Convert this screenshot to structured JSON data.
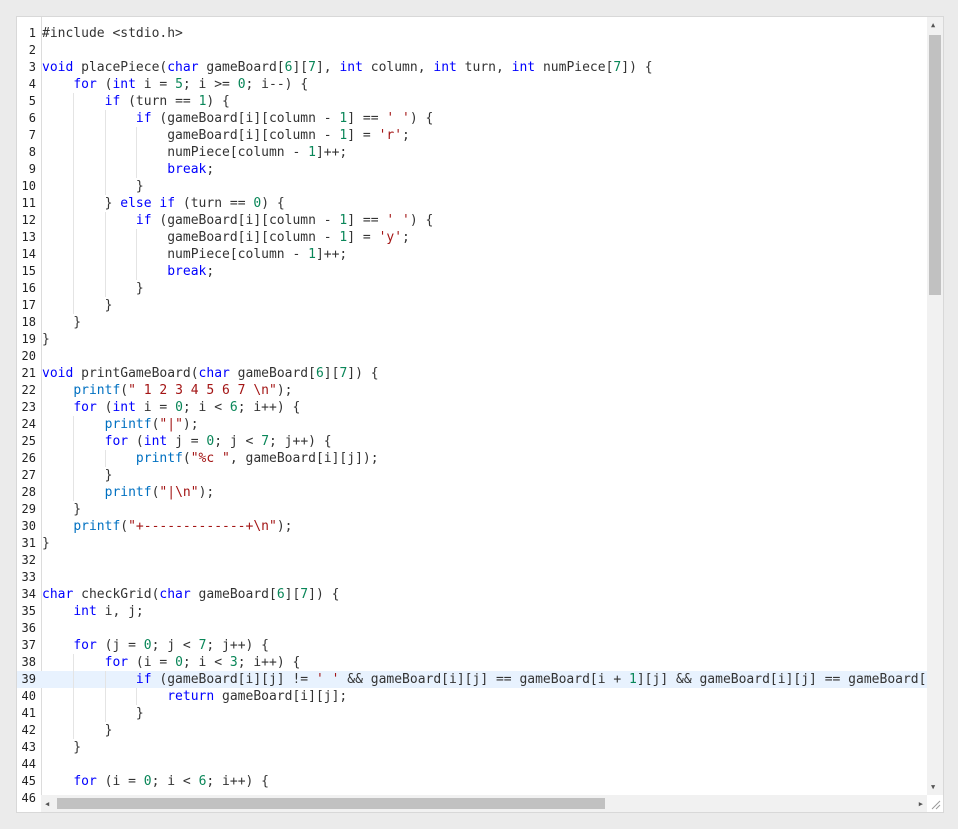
{
  "editor": {
    "lines": [
      {
        "n": "1",
        "t": "#include <stdio.h>"
      },
      {
        "n": "2",
        "t": ""
      },
      {
        "n": "3",
        "t": "void placePiece(char gameBoard[6][7], int column, int turn, int numPiece[7]) {"
      },
      {
        "n": "4",
        "t": "    for (int i = 5; i >= 0; i--) {"
      },
      {
        "n": "5",
        "t": "        if (turn == 1) {"
      },
      {
        "n": "6",
        "t": "            if (gameBoard[i][column - 1] == ' ') {"
      },
      {
        "n": "7",
        "t": "                gameBoard[i][column - 1] = 'r';"
      },
      {
        "n": "8",
        "t": "                numPiece[column - 1]++;"
      },
      {
        "n": "9",
        "t": "                break;"
      },
      {
        "n": "10",
        "t": "            }"
      },
      {
        "n": "11",
        "t": "        } else if (turn == 0) {"
      },
      {
        "n": "12",
        "t": "            if (gameBoard[i][column - 1] == ' ') {"
      },
      {
        "n": "13",
        "t": "                gameBoard[i][column - 1] = 'y';"
      },
      {
        "n": "14",
        "t": "                numPiece[column - 1]++;"
      },
      {
        "n": "15",
        "t": "                break;"
      },
      {
        "n": "16",
        "t": "            }"
      },
      {
        "n": "17",
        "t": "        }"
      },
      {
        "n": "18",
        "t": "    }"
      },
      {
        "n": "19",
        "t": "}"
      },
      {
        "n": "20",
        "t": ""
      },
      {
        "n": "21",
        "t": "void printGameBoard(char gameBoard[6][7]) {"
      },
      {
        "n": "22",
        "t": "    printf(\" 1 2 3 4 5 6 7 \\n\");"
      },
      {
        "n": "23",
        "t": "    for (int i = 0; i < 6; i++) {"
      },
      {
        "n": "24",
        "t": "        printf(\"|\");"
      },
      {
        "n": "25",
        "t": "        for (int j = 0; j < 7; j++) {"
      },
      {
        "n": "26",
        "t": "            printf(\"%c \", gameBoard[i][j]);"
      },
      {
        "n": "27",
        "t": "        }"
      },
      {
        "n": "28",
        "t": "        printf(\"|\\n\");"
      },
      {
        "n": "29",
        "t": "    }"
      },
      {
        "n": "30",
        "t": "    printf(\"+-------------+\\n\");"
      },
      {
        "n": "31",
        "t": "}"
      },
      {
        "n": "32",
        "t": ""
      },
      {
        "n": "33",
        "t": ""
      },
      {
        "n": "34",
        "t": "char checkGrid(char gameBoard[6][7]) {"
      },
      {
        "n": "35",
        "t": "    int i, j;"
      },
      {
        "n": "36",
        "t": ""
      },
      {
        "n": "37",
        "t": "    for (j = 0; j < 7; j++) {"
      },
      {
        "n": "38",
        "t": "        for (i = 0; i < 3; i++) {"
      },
      {
        "n": "39",
        "t": "            if (gameBoard[i][j] != ' ' && gameBoard[i][j] == gameBoard[i + 1][j] && gameBoard[i][j] == gameBoard[i"
      },
      {
        "n": "40",
        "t": "                return gameBoard[i][j];"
      },
      {
        "n": "41",
        "t": "            }"
      },
      {
        "n": "42",
        "t": "        }"
      },
      {
        "n": "43",
        "t": "    }"
      },
      {
        "n": "44",
        "t": ""
      },
      {
        "n": "45",
        "t": "    for (i = 0; i < 6; i++) {"
      },
      {
        "n": "46",
        "t": ""
      }
    ],
    "active_line": "39",
    "colors": {
      "keyword": "#0000ff",
      "number": "#098658",
      "string": "#a31515",
      "type": "#0070c1",
      "active_line_bg": "#e8f2fe"
    }
  },
  "icons": {
    "scroll_up": "triangle-up",
    "scroll_down": "triangle-down",
    "scroll_left": "triangle-left",
    "scroll_right": "triangle-right",
    "resize": "resize-grip"
  }
}
